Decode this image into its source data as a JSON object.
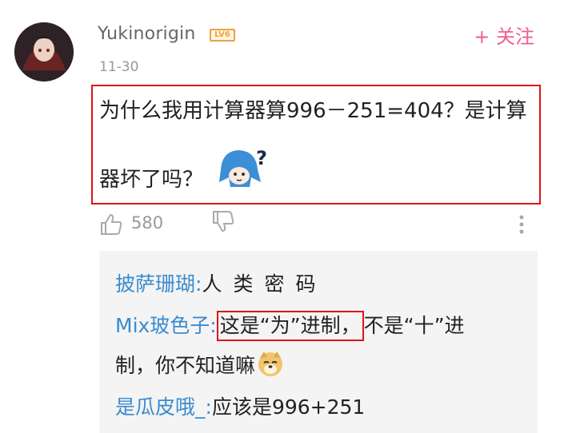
{
  "comment": {
    "username": "Yukinorigin",
    "level_badge": "LV6",
    "follow_label": "+ 关注",
    "date": "11-30",
    "text_line1": "为什么我用计算器算996－251=404？是计算",
    "text_line2": "器坏了吗？",
    "like_count": "580"
  },
  "replies": [
    {
      "user": "披萨珊瑚:",
      "text": "人类密码"
    },
    {
      "user": "Mix玻色子:",
      "highlight": "这是“为”进制，",
      "text": "不是“十”进",
      "text_cont": "制，你不知道嘛"
    },
    {
      "user": "是瓜皮哦_:",
      "text": "应该是996+251"
    }
  ],
  "colors": {
    "accent_pink": "#f25d8e",
    "link_blue": "#3a8bd0",
    "highlight_red": "#e0121b",
    "badge_orange": "#f0a23c"
  },
  "icons": [
    "avatar",
    "sticker-question-icon",
    "thumbs-up-icon",
    "thumbs-down-icon",
    "more-vertical-icon",
    "doge-emoji-icon"
  ]
}
